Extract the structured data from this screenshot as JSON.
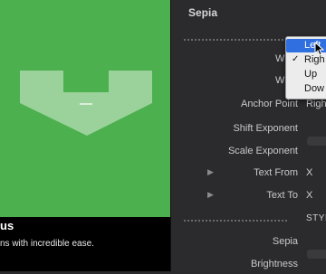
{
  "preview": {
    "caption_title": "us",
    "caption_sub": "ns with incredible ease.",
    "arrow_fill": "#9fd49f",
    "bg_color": "#4cb04e"
  },
  "panel": {
    "title": "Sepia",
    "rows": [
      {
        "label": "Wipe",
        "value": ""
      },
      {
        "label": "Wipe",
        "value": ""
      },
      {
        "label": "Anchor Point",
        "value": "Righ"
      },
      {
        "label": "Shift Exponent",
        "value": ""
      },
      {
        "label": "Scale Exponent",
        "value": ""
      },
      {
        "label": "Text From",
        "value": "X"
      },
      {
        "label": "Text To",
        "value": "X"
      }
    ],
    "section_label": "STYL",
    "style_rows": [
      {
        "label": "Sepia"
      },
      {
        "label": "Brightness"
      }
    ]
  },
  "menu": {
    "items": [
      {
        "label": "Left",
        "selected": true,
        "checked": false
      },
      {
        "label": "Righ",
        "selected": false,
        "checked": true
      },
      {
        "label": "Up",
        "selected": false,
        "checked": false
      },
      {
        "label": "Dow",
        "selected": false,
        "checked": false
      }
    ],
    "check_glyph": "✓"
  },
  "icons": {
    "disclosure": "▶"
  }
}
